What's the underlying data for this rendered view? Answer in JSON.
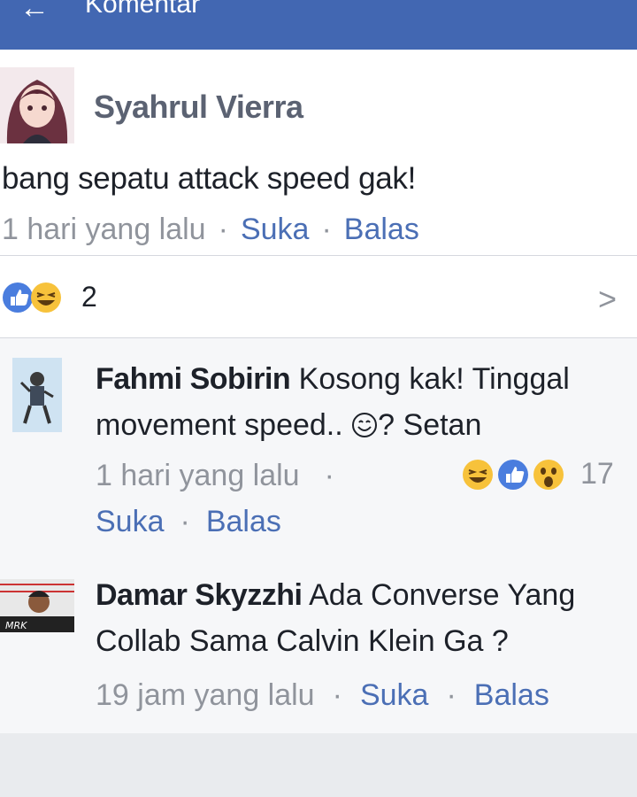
{
  "header": {
    "title": "Komentar",
    "back_icon": "back-arrow-icon"
  },
  "post": {
    "author": "Syahrul Vierra",
    "text": "bang sepatu attack speed gak!",
    "time": "1 hari yang lalu",
    "like_label": "Suka",
    "reply_label": "Balas",
    "reactions": {
      "icons": [
        "like-icon",
        "haha-icon"
      ],
      "count": "2"
    }
  },
  "replies": [
    {
      "author": "Fahmi Sobirin",
      "text_before": "Kosong kak! Tinggal movement speed..",
      "emoji": "smile-emoji-icon",
      "text_after": "?  Setan",
      "time": "1 hari yang lalu",
      "like_label": "Suka",
      "reply_label": "Balas",
      "reactions": {
        "icons": [
          "haha-icon",
          "like-icon",
          "wow-icon"
        ],
        "count": "17"
      }
    },
    {
      "author": "Damar Skyzzhi",
      "text": "Ada Converse Yang Collab Sama Calvin Klein Ga ?",
      "time": "19 jam yang lalu",
      "like_label": "Suka",
      "reply_label": "Balas"
    }
  ],
  "colors": {
    "header": "#4267b2",
    "link": "#4b6fb5",
    "meta": "#90949c"
  }
}
